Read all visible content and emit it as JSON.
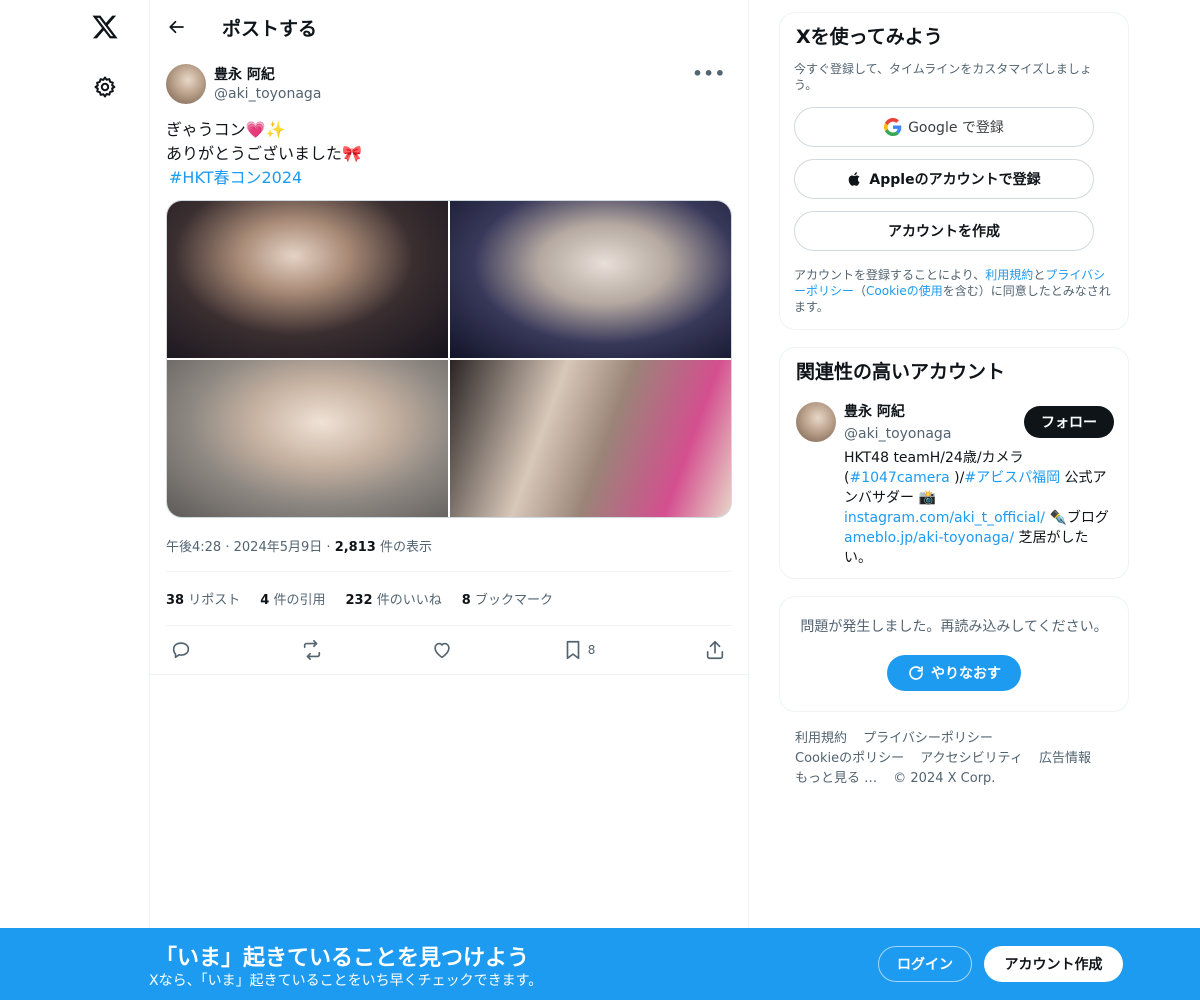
{
  "nav": {
    "logo_icon": "x-logo-icon",
    "settings_icon": "gear-icon"
  },
  "header": {
    "title": "ポストする"
  },
  "post": {
    "author_name": "豊永 阿紀",
    "author_handle": "@aki_toyonaga",
    "more_icon": "•••",
    "line1": "ぎゃうコン💗✨",
    "line2": "ありがとうございました🎀",
    "hashtag": "#HKT春コン2024",
    "time": "午後4:28",
    "date": "2024年5月9日",
    "views_count": "2,813",
    "views_label": "件の表示",
    "separator": "·",
    "stats": [
      {
        "count": "38",
        "label": "リポスト"
      },
      {
        "count": "4",
        "label": "件の引用"
      },
      {
        "count": "232",
        "label": "件のいいね"
      },
      {
        "count": "8",
        "label": "ブックマーク"
      }
    ],
    "bookmark_count": "8"
  },
  "signup_card": {
    "title": "Xを使ってみよう",
    "subtitle": "今すぐ登録して、タイムラインをカスタマイズしましょう。",
    "google_label": "Google で登録",
    "apple_label": "Appleのアカウントで登録",
    "create_label": "アカウントを作成",
    "legal_1": "アカウントを登録することにより、",
    "legal_terms": "利用規約",
    "legal_2": "と",
    "legal_privacy": "プライバシーポリシー",
    "legal_3": "（",
    "legal_cookie": "Cookieの使用",
    "legal_4": "を含む）に同意したとみなされます。"
  },
  "related_card": {
    "title": "関連性の高いアカウント",
    "name": "豊永 阿紀",
    "handle": "@aki_toyonaga",
    "follow_label": "フォロー",
    "bio_1": "HKT48 teamH/24歳/カメラ(",
    "bio_tag1": "#1047camera",
    "bio_2": " )/",
    "bio_tag2": "#アビスパ福岡",
    "bio_3": " 公式アンバサダー 📸",
    "bio_link1": "instagram.com/aki_t_official/",
    "bio_4": " ✒️ブログ ",
    "bio_link2": "ameblo.jp/aki-toyonaga/",
    "bio_5": " 芝居がしたい。"
  },
  "error_card": {
    "message": "問題が発生しました。再読み込みしてください。",
    "retry_label": "やりなおす"
  },
  "footer": {
    "links": [
      "利用規約",
      "プライバシーポリシー",
      "Cookieのポリシー",
      "アクセシビリティ",
      "広告情報",
      "もっと見る …",
      "© 2024 X Corp."
    ]
  },
  "banner": {
    "title": "「いま」起きていることを見つけよう",
    "subtitle": "Xなら、「いま」起きていることをいち早くチェックできます。",
    "login_label": "ログイン",
    "signup_label": "アカウント作成"
  },
  "colors": {
    "accent": "#1d9bf0",
    "text": "#0f1419",
    "muted": "#536471",
    "border": "#eff3f4"
  }
}
